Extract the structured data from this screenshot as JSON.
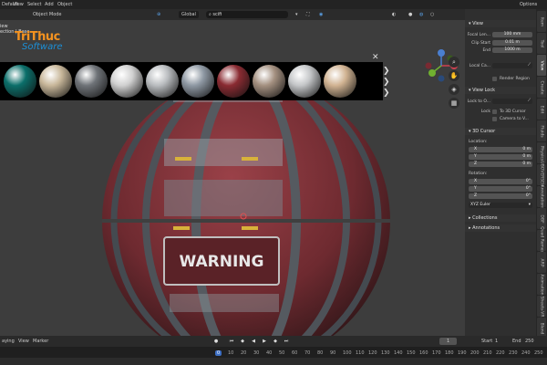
{
  "menu": {
    "workspace": "Default",
    "items": [
      "View",
      "Select",
      "Add",
      "Object"
    ],
    "object_mode": "Object Mode",
    "options": "Options"
  },
  "header": {
    "transform": "Global",
    "search": "scifi",
    "left_labels": [
      "iew",
      "ection | Base"
    ]
  },
  "logo": {
    "line1": "TriThuc",
    "line2": "Software"
  },
  "viewport": {
    "sign_text": "WARNING"
  },
  "materials": [
    {
      "name": "teal-sphere",
      "color": "#0b6f6a"
    },
    {
      "name": "tile-sphere",
      "color": "#c8b79a"
    },
    {
      "name": "metal-grid-sphere",
      "color": "#6f7378"
    },
    {
      "name": "sci-panel-sphere",
      "color": "#d0d0d0"
    },
    {
      "name": "grey-tile-sphere",
      "color": "#b9bcbf"
    },
    {
      "name": "chrome-sphere",
      "color": "#8e98a3"
    },
    {
      "name": "red-panel-sphere",
      "color": "#8a2b32"
    },
    {
      "name": "metal-plate-sphere",
      "color": "#a49080"
    },
    {
      "name": "silver-sphere",
      "color": "#c4c6c8"
    },
    {
      "name": "brick-sphere",
      "color": "#d1b392"
    }
  ],
  "sidebar": {
    "view_header": "View",
    "focal_length_label": "Focal Len...",
    "focal_length_value": "100 mm",
    "clip_start_label": "Clip Start",
    "clip_start_value": "0.01 m",
    "end_label": "End",
    "end_value": "1000 m",
    "local_camera_label": "Local Ca...",
    "render_region_label": "Render Region",
    "view_lock_header": "View Lock",
    "lock_to_object_label": "Lock to O...",
    "lock_label": "Lock",
    "to_3d_cursor_label": "To 3D Cursor",
    "camera_to_view_label": "Camera to V...",
    "cursor_header": "3D Cursor",
    "location_label": "Location:",
    "loc_x_label": "X",
    "loc_x_value": "0 m",
    "loc_y_label": "Y",
    "loc_y_value": "0 m",
    "loc_z_label": "Z",
    "loc_z_value": "0 m",
    "rotation_label": "Rotation:",
    "rot_x_label": "X",
    "rot_x_value": "0°",
    "rot_y_label": "Y",
    "rot_y_value": "0°",
    "rot_z_label": "Z",
    "rot_z_value": "0°",
    "rotation_mode": "XYZ Euler",
    "collections_header": "Collections",
    "annotations_header": "Annotations"
  },
  "tabs": [
    "Item",
    "Tool",
    "View",
    "Create",
    "Edit",
    "Fluids",
    "Physics",
    "UBOVERSEHC",
    "Annotations",
    "DBF",
    "Quad Remesh",
    "ARP",
    "Animation",
    "Sheets-VR",
    "Blend"
  ],
  "timeline": {
    "playback": "aying",
    "view": "View",
    "marker": "Marker",
    "current_frame": "1",
    "start_label": "Start",
    "start_value": "1",
    "end_label": "End",
    "end_value": "250"
  },
  "ruler_ticks": [
    "0",
    "10",
    "20",
    "30",
    "40",
    "50",
    "60",
    "70",
    "80",
    "90",
    "100",
    "110",
    "120",
    "130",
    "140",
    "150",
    "160",
    "170",
    "180",
    "190",
    "200",
    "210",
    "220",
    "230",
    "240",
    "250"
  ],
  "colors": {
    "accent_blue": "#3d6fc4",
    "logo_orange": "#f39220",
    "logo_blue": "#1c8fd6"
  }
}
